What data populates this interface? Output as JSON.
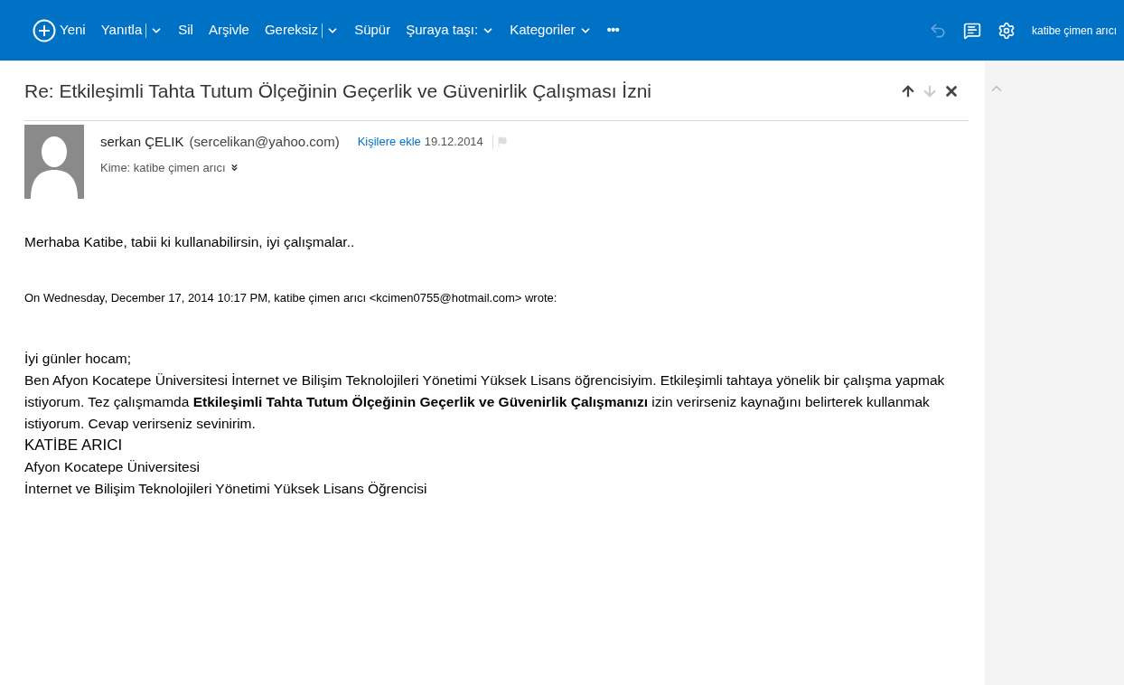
{
  "toolbar": {
    "items": [
      {
        "kind": "new",
        "label": "Yeni"
      },
      {
        "kind": "split",
        "label": "Yanıtla"
      },
      {
        "kind": "plain",
        "label": "Sil"
      },
      {
        "kind": "plain",
        "label": "Arşivle"
      },
      {
        "kind": "split",
        "label": "Gereksiz"
      },
      {
        "kind": "plain",
        "label": "Süpür"
      },
      {
        "kind": "dropdown",
        "label": "Şuraya taşı:"
      },
      {
        "kind": "dropdown",
        "label": "Kategoriler"
      },
      {
        "kind": "more",
        "label": "•••"
      }
    ],
    "undo": {
      "disabled": true
    },
    "user": "katibe çimen arıcı"
  },
  "message": {
    "subject": "Re: Etkileşimli Tahta Tutum Ölçeğinin Geçerlik ve Güvenirlik Çalışması İzni",
    "nav": {
      "previous_disabled": false,
      "next_disabled": true
    },
    "sender_name": "serkan ÇELIK",
    "sender_email": "(sercelikan@yahoo.com)",
    "add_contact": "Kişilere ekle",
    "date": "19.12.2014",
    "flagged": false,
    "to": "Kime: katibe çimen arıcı",
    "body": [
      {
        "kind": "text",
        "text": "Merhaba Katibe, tabii ki kullanabilirsin, iyi çalışmalar.."
      },
      {
        "kind": "quote",
        "text": "On Wednesday, December 17, 2014 10:17 PM, katibe çimen arıcı <kcimen0755@hotmail.com> wrote:"
      },
      {
        "kind": "text",
        "text": "İyi günler hocam;"
      },
      {
        "kind": "text",
        "text": "Ben Afyon Kocatepe Üniversitesi  İnternet ve Bilişim Teknolojileri Yönetimi Yüksek Lisans öğrencisiyim. Etkileşimli tahtaya yönelik bir çalışma yapmak istiyorum. Tez çalışmamda **Etkileşimli Tahta Tutum Ölçeğinin Geçerlik ve Güvenirlik Çalışmanızı** izin verirseniz kaynağını belirterek kullanmak istiyorum. Cevap verirseniz sevinirim."
      },
      {
        "kind": "large",
        "text": "KATİBE ARICI"
      },
      {
        "kind": "text",
        "text": "Afyon Kocatepe Üniversitesi"
      },
      {
        "kind": "text",
        "text": "İnternet ve Bilişim Teknolojileri Yönetimi Yüksek Lisans Öğrencisi"
      }
    ]
  }
}
